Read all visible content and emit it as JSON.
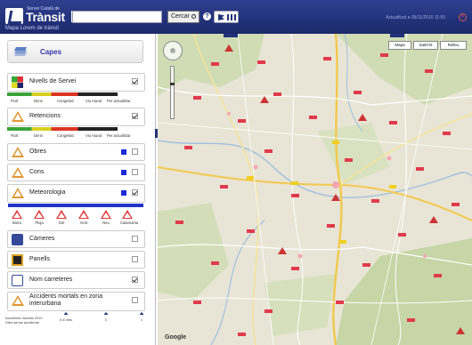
{
  "header": {
    "logo_sup": "Servei Català de",
    "logo_name": "Trànsit",
    "logo_mct": "mct",
    "subtitle": "Mapa Lorem de trànsit",
    "search_placeholder": "",
    "search_label": "Cercar",
    "help": "?",
    "updated": "Actualitzat a 05/11/2010 11:55",
    "colors": {
      "bar": "#22327a",
      "accent": "#1f33c7"
    }
  },
  "sidebar": {
    "header_label": "Capes",
    "layers": [
      {
        "label": "Nivells de Servei",
        "checked": true,
        "icon": "traffic-grid-icon"
      },
      {
        "label": "Retencions",
        "checked": true,
        "icon": "warning-icon"
      },
      {
        "label": "Obres",
        "checked": false,
        "icon": "roadworks-icon"
      },
      {
        "label": "Cons",
        "checked": false,
        "icon": "cones-icon"
      },
      {
        "label": "Meteorologia",
        "checked": true,
        "icon": "weather-icon"
      },
      {
        "label": "Càmeres",
        "checked": false,
        "icon": "camera-icon"
      },
      {
        "label": "Panells",
        "checked": false,
        "icon": "panel-icon"
      },
      {
        "label": "Nom carreteres",
        "checked": true,
        "icon": "road-name-icon"
      },
      {
        "label": "Accidents mortals en zona interurbana",
        "checked": false,
        "icon": "accident-icon"
      }
    ],
    "legend_service": [
      "Fluït",
      "Dens",
      "Congestió",
      "Viu Aturat",
      "Per actualitzar"
    ],
    "legend_retention": [
      "Fluït",
      "Dens",
      "Congestió",
      "Viu Aturat",
      "Per actualitzar"
    ],
    "meteo_labels": [
      "Boira",
      "Pluja",
      "Gel",
      "Vent",
      "Neu",
      "Calamarsa"
    ],
    "footer": {
      "left_label": "Accidents mortals 2010",
      "left_sub": "Dies sense accidents",
      "col1": "0 a més",
      "col2": "2",
      "col3": "1"
    }
  },
  "map": {
    "buttons": [
      "Mapa",
      "Satèl·lit",
      "Relleu"
    ],
    "google": "Google"
  }
}
